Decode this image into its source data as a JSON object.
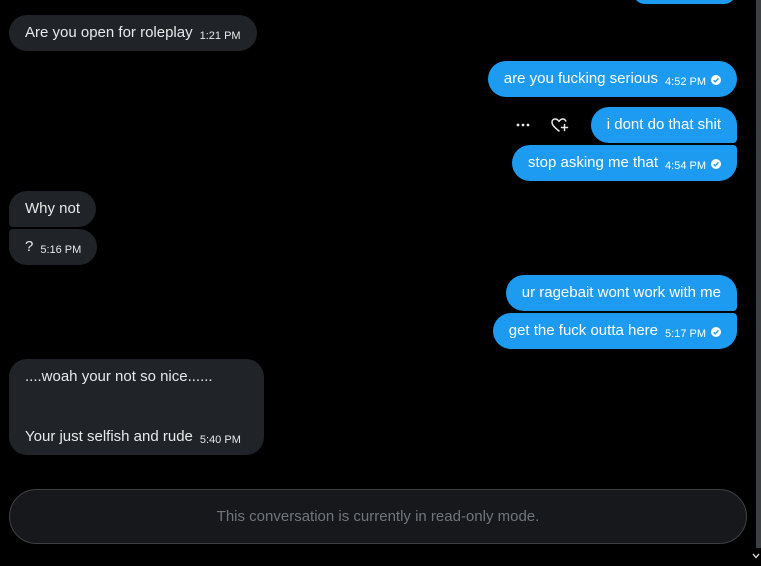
{
  "messages": [
    {
      "id": "m0",
      "dir": "out",
      "text": "",
      "time": "",
      "partial": true
    },
    {
      "id": "m1",
      "dir": "in",
      "text": "Are you open for roleplay",
      "time": "1:21 PM"
    },
    {
      "id": "m2",
      "dir": "out",
      "text": "are you fucking serious",
      "time": "4:52 PM"
    },
    {
      "id": "m3",
      "dir": "out",
      "text": "i dont do that shit",
      "time": ""
    },
    {
      "id": "m4",
      "dir": "out",
      "text": "stop asking me that",
      "time": "4:54 PM"
    },
    {
      "id": "m5",
      "dir": "in",
      "text": "Why not",
      "time": ""
    },
    {
      "id": "m6",
      "dir": "in",
      "text": "?",
      "time": "5:16 PM"
    },
    {
      "id": "m7",
      "dir": "out",
      "text": "ur ragebait wont work with me",
      "time": ""
    },
    {
      "id": "m8",
      "dir": "out",
      "text": "get the fuck outta here",
      "time": "5:17 PM"
    },
    {
      "id": "m9",
      "dir": "in",
      "line1": "....woah your not so nice......",
      "line2": "Your just selfish and rude",
      "time": "5:40 PM"
    }
  ],
  "hover_actions": {
    "more_icon": "more-horizontal-icon",
    "react_icon": "heart-plus-icon"
  },
  "composer": {
    "readonly_text": "This conversation is currently in read-only mode."
  },
  "colors": {
    "outgoing": "#1d9bf0",
    "incoming": "#202327",
    "background": "#000000",
    "muted": "#71767b"
  }
}
